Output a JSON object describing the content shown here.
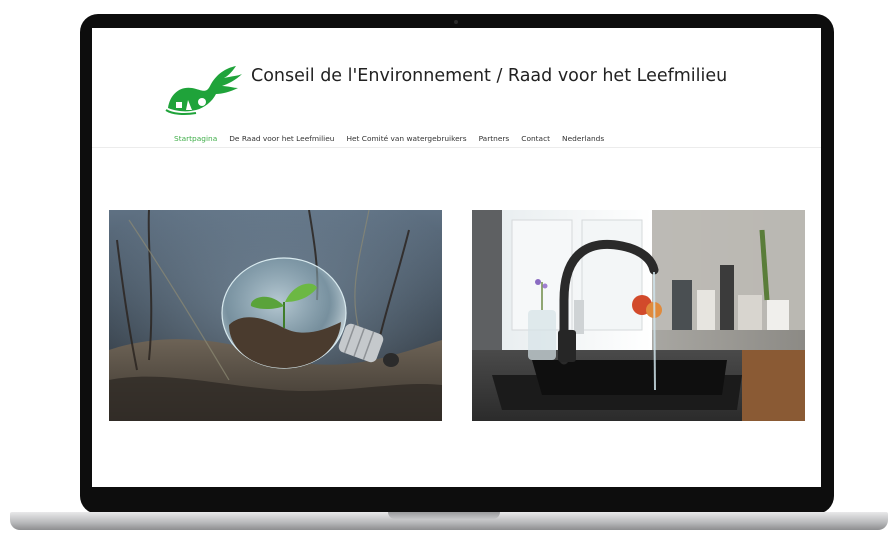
{
  "site": {
    "title": "Conseil de l'Environnement / Raad voor het Leefmilieu"
  },
  "nav": {
    "items": [
      {
        "label": "Startpagina",
        "active": true
      },
      {
        "label": "De Raad voor het Leefmilieu",
        "active": false
      },
      {
        "label": "Het Comité van watergebruikers",
        "active": false
      },
      {
        "label": "Partners",
        "active": false
      },
      {
        "label": "Contact",
        "active": false
      },
      {
        "label": "Nederlands",
        "active": false
      }
    ]
  },
  "colors": {
    "accent": "#3fae49",
    "logo_green": "#1fa33a",
    "text": "#222222"
  },
  "icons": {
    "logo": "green-hand-bird-logo"
  }
}
